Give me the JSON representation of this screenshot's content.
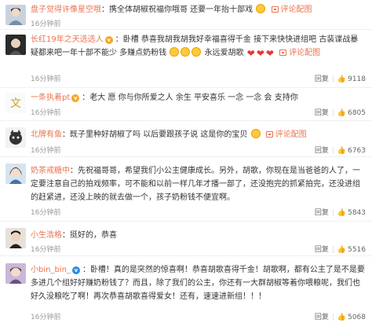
{
  "reply_label": "回复",
  "view_pic_label": "评论配图",
  "comments": [
    {
      "user": "盘子觉得许像星空哦",
      "text": "携全体胡椒祝福你哦哥 还要一年抬十部戏",
      "time": "16分钟前",
      "likes": ""
    },
    {
      "user": "长红19年之天选选人",
      "text": "卧槽 恭喜我胡我胡我好幸福喜得千金 接下来快快进组吧 古装谍战暴疑都来吧一年十部不能少 多赚点奶粉钱",
      "text2": "永远爱胡歌",
      "time": "16分钟前",
      "likes": "9118"
    },
    {
      "user": "一条执着pt",
      "text": "老大 愿 你与你所爱之人 余生 平安喜乐 一念 一念 会 支持你",
      "time": "16分钟前",
      "likes": "6805"
    },
    {
      "user": "北牌有鱼",
      "text": "既子里种好胡椒了吗 以后要跟孩子说 这是你的宝贝",
      "time": "16分钟前",
      "likes": "6763"
    },
    {
      "user": "奶茶戒糖中",
      "text": "先祝福哥哥，希望我们小公主健康成长。另外，胡歌，你现在是当爸爸的人了，一定要注意自己的拍戏频率，可不能和以前一样几年才播一部了，还没抱完的抓紧拍完，还没进组的赶紧进，还没上映的就去做一个，孩子奶粉钱不便宜啊。",
      "time": "16分钟前",
      "likes": "5843"
    },
    {
      "user": "小生浩格",
      "text": "挺好的，恭喜",
      "time": "16分钟前",
      "likes": "5516"
    },
    {
      "user": "小bin_bin_",
      "text": "卧槽！真的是突然的惊喜啊！恭喜胡歌喜得千金！胡歌啊，都有公主了是不是要多进几个组好好赚奶粉钱了？而且，除了我们的公主，你还有一大群胡椒等着你喂粮呢，我们也好久没粮吃了啊！再次恭喜胡歌喜得爱女！还有，速速进新组！！！",
      "time": "16分钟前",
      "likes": "5068"
    }
  ]
}
